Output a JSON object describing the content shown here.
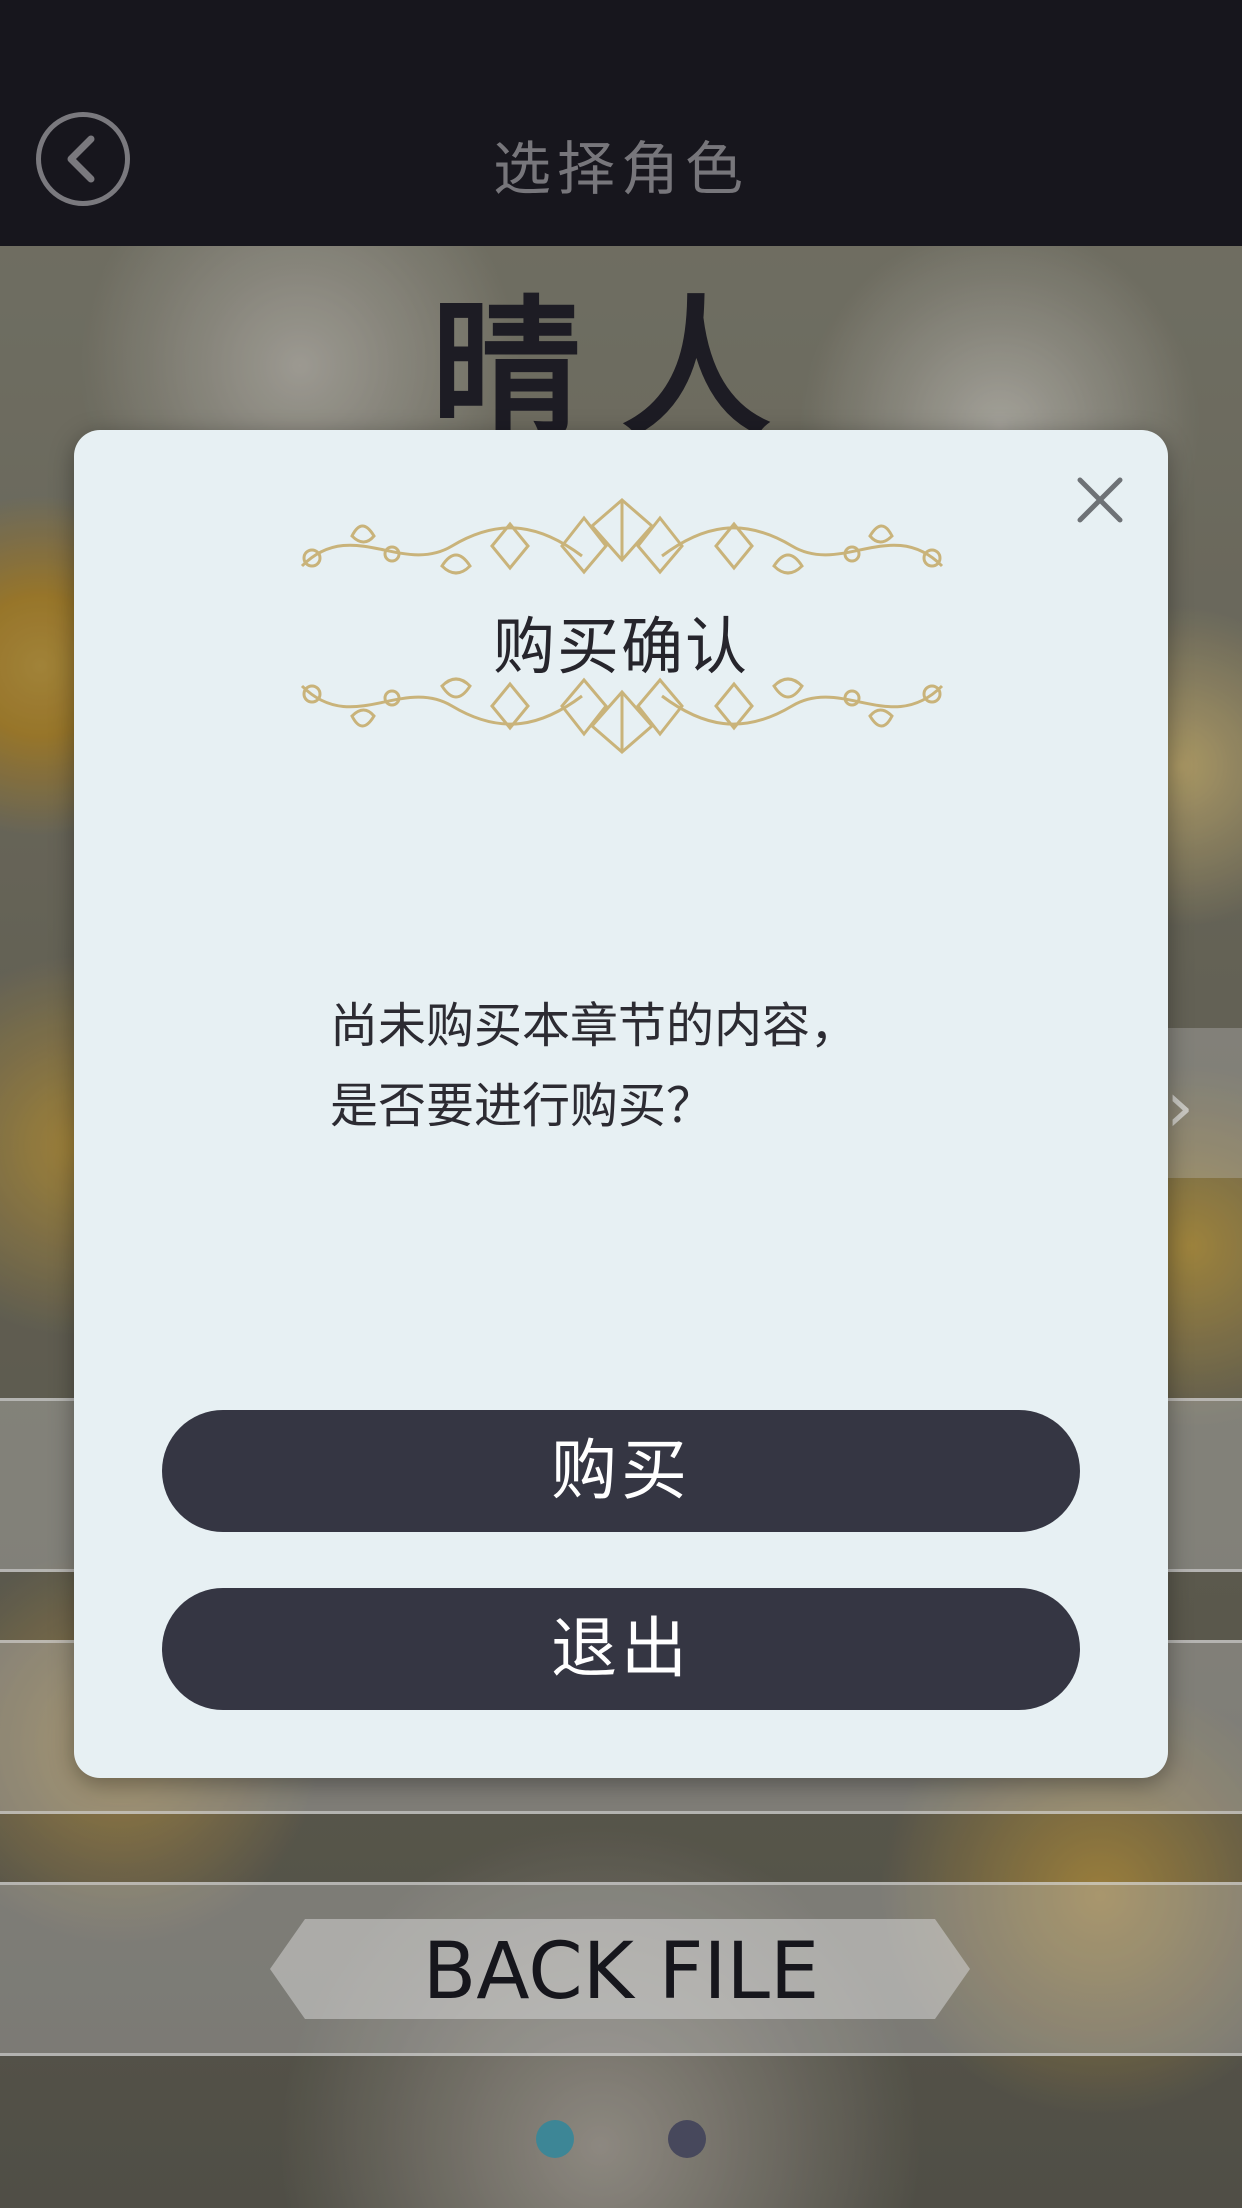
{
  "header": {
    "title": "选择角色",
    "back_icon": "chevron-left-circle-icon"
  },
  "character": {
    "name": "晴人"
  },
  "background_menu": {
    "back_file_label": "BACK FILE"
  },
  "pagination": {
    "active_color": "#3f8fa0",
    "inactive_color": "#4a4b61"
  },
  "modal": {
    "title": "购买确认",
    "message_line1": "尚未购买本章节的内容，",
    "message_line2": "是否要进行购买？",
    "buy_label": "购买",
    "exit_label": "退出",
    "close_icon": "close-icon",
    "ornament_color": "#c9b37a",
    "button_color": "#353643",
    "background_color": "#e7f0f3"
  }
}
